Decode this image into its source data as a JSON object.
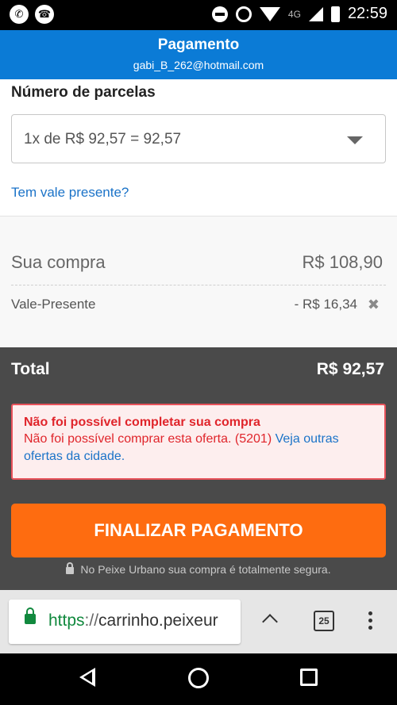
{
  "status_bar": {
    "left_icons": [
      "whatsapp-icon",
      "phone-icon"
    ],
    "network": "4G",
    "time": "22:59"
  },
  "header": {
    "title": "Pagamento",
    "email": "gabi_B_262@hotmail.com",
    "color": "#0b7bd6"
  },
  "installments": {
    "label": "Número de parcelas",
    "selected": "1x de R$ 92,57 = 92,57"
  },
  "gift_link": "Tem vale presente?",
  "summary": {
    "purchase_label": "Sua compra",
    "purchase_value": "R$ 108,90",
    "gift_label": "Vale-Presente",
    "gift_value": "- R$ 16,34"
  },
  "total": {
    "label": "Total",
    "value": "R$ 92,57"
  },
  "error": {
    "title": "Não foi possível completar sua compra",
    "message": "Não foi possível comprar esta oferta. (5201)",
    "link": "Veja outras ofertas da cidade."
  },
  "checkout_button": {
    "label": "FINALIZAR PAGAMENTO",
    "color": "#fe6c10"
  },
  "secure_note": "No Peixe Urbano sua compra é totalmente segura.",
  "browser": {
    "url_scheme": "https",
    "url_sep": "://",
    "url_host": "carrinho.peixeur",
    "tab_count": "25"
  }
}
